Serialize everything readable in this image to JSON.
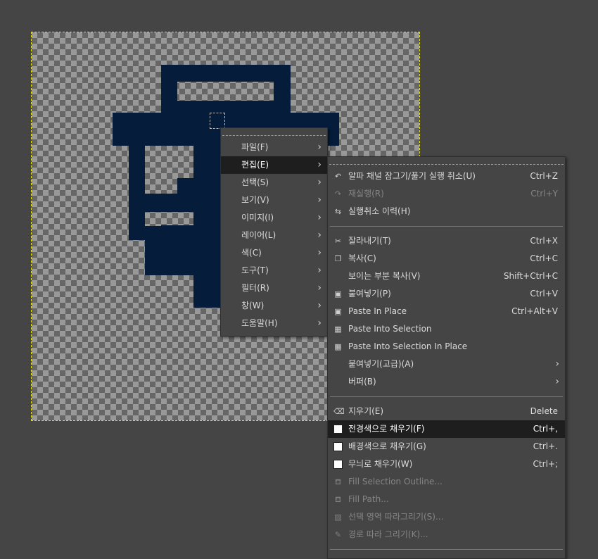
{
  "main_menu": {
    "items": [
      {
        "label": "파일(F)"
      },
      {
        "label": "편집(E)"
      },
      {
        "label": "선택(S)"
      },
      {
        "label": "보기(V)"
      },
      {
        "label": "이미지(I)"
      },
      {
        "label": "레이어(L)"
      },
      {
        "label": "색(C)"
      },
      {
        "label": "도구(T)"
      },
      {
        "label": "필터(R)"
      },
      {
        "label": "창(W)"
      },
      {
        "label": "도움말(H)"
      }
    ]
  },
  "edit_menu": {
    "undo": {
      "label": "알파 채널 잠그기/풀기 실행 취소(U)",
      "shortcut": "Ctrl+Z"
    },
    "redo": {
      "label": "재실행(R)",
      "shortcut": "Ctrl+Y"
    },
    "history": {
      "label": "실행취소 이력(H)"
    },
    "cut": {
      "label": "잘라내기(T)",
      "shortcut": "Ctrl+X"
    },
    "copy": {
      "label": "복사(C)",
      "shortcut": "Ctrl+C"
    },
    "copy_visible": {
      "label": "보이는 부분 복사(V)",
      "shortcut": "Shift+Ctrl+C"
    },
    "paste": {
      "label": "붙여넣기(P)",
      "shortcut": "Ctrl+V"
    },
    "paste_in_place": {
      "label": "Paste In Place",
      "shortcut": "Ctrl+Alt+V"
    },
    "paste_into_selection": {
      "label": "Paste Into Selection"
    },
    "paste_into_selection_in_place": {
      "label": "Paste Into Selection In Place"
    },
    "paste_as": {
      "label": "붙여넣기(고급)(A)"
    },
    "buffer": {
      "label": "버퍼(B)"
    },
    "clear": {
      "label": "지우기(E)",
      "shortcut": "Delete"
    },
    "fill_fg": {
      "label": "전경색으로 채우기(F)",
      "shortcut": "Ctrl+,"
    },
    "fill_bg": {
      "label": "배경색으로 채우기(G)",
      "shortcut": "Ctrl+."
    },
    "fill_pattern": {
      "label": "무늬로 채우기(W)",
      "shortcut": "Ctrl+;"
    },
    "fill_selection_outline": {
      "label": "Fill Selection Outline..."
    },
    "fill_path": {
      "label": "Fill Path..."
    },
    "stroke_selection": {
      "label": "선택 영역 따라그리기(S)..."
    },
    "stroke_path": {
      "label": "경로 따라 그리기(K)..."
    }
  },
  "colors": {
    "shape": "#051c3b",
    "menu_bg": "#454545",
    "highlight": "#1e1e1e",
    "selection_border": "#e6e000"
  }
}
